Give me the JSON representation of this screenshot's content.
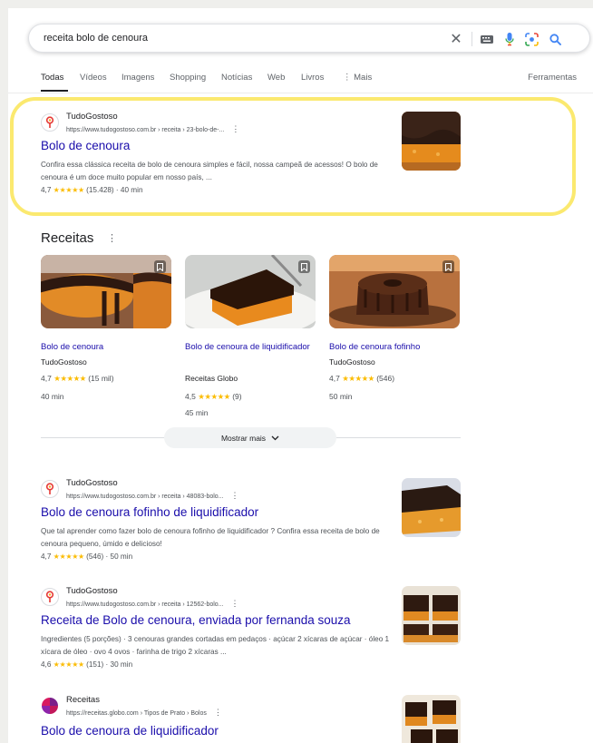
{
  "search": {
    "query": "receita bolo de cenoura"
  },
  "tabs": [
    "Todas",
    "Vídeos",
    "Imagens",
    "Shopping",
    "Notícias",
    "Web",
    "Livros",
    "⋮ Mais"
  ],
  "tools_label": "Ferramentas",
  "results": [
    {
      "site": "TudoGostoso",
      "url": "https://www.tudogostoso.com.br › receita › 23-bolo-de-...",
      "title": "Bolo de cenoura",
      "snippet": "Confira essa clássica receita de bolo de cenoura simples e fácil, nossa campeã de acessos! O bolo de cenoura é um doce muito popular em nosso país, ...",
      "rating": "4,7",
      "stars": "★★★★★",
      "meta": "(15.428) · 40 min"
    },
    {
      "site": "TudoGostoso",
      "url": "https://www.tudogostoso.com.br › receita › 48083-bolo...",
      "title": "Bolo de cenoura fofinho de liquidificador",
      "snippet": "Que tal aprender como fazer bolo de cenoura fofinho de liquidificador ? Confira essa receita de bolo de cenoura pequeno, úmido e delicioso!",
      "rating": "4,7",
      "stars": "★★★★★",
      "meta": "(546) · 50 min"
    },
    {
      "site": "TudoGostoso",
      "url": "https://www.tudogostoso.com.br › receita › 12562-bolo...",
      "title": "Receita de Bolo de cenoura, enviada por fernanda souza",
      "snippet": "Ingredientes (5 porções) · 3 cenouras grandes cortadas em pedaços · açúcar 2 xícaras de açúcar · óleo 1 xícara de óleo · ovo 4 ovos · farinha de trigo 2 xícaras ...",
      "rating": "4,6",
      "stars": "★★★★★",
      "meta": "(151) · 30 min"
    },
    {
      "site": "Receitas",
      "url": "https://receitas.globo.com › Tipos de Prato › Bolos",
      "title": "Bolo de cenoura de liquidificador"
    }
  ],
  "recipes": {
    "title": "Receitas",
    "more_label": "Mostrar mais",
    "cards": [
      {
        "title": "Bolo de cenoura",
        "source": "TudoGostoso",
        "rating": "4,7",
        "stars": "★★★★★",
        "count": "(15 mil)",
        "time": "40 min"
      },
      {
        "title": "Bolo de cenoura de liquidificador",
        "source": "Receitas Globo",
        "rating": "4,5",
        "stars": "★★★★★",
        "count": "(9)",
        "time": "45 min"
      },
      {
        "title": "Bolo de cenoura fofinho",
        "source": "TudoGostoso",
        "rating": "4,7",
        "stars": "★★★★★",
        "count": "(546)",
        "time": "50 min"
      }
    ]
  },
  "colors": {
    "link": "#1a0dab",
    "highlight": "#fbe96f",
    "star": "#fbbc04"
  }
}
